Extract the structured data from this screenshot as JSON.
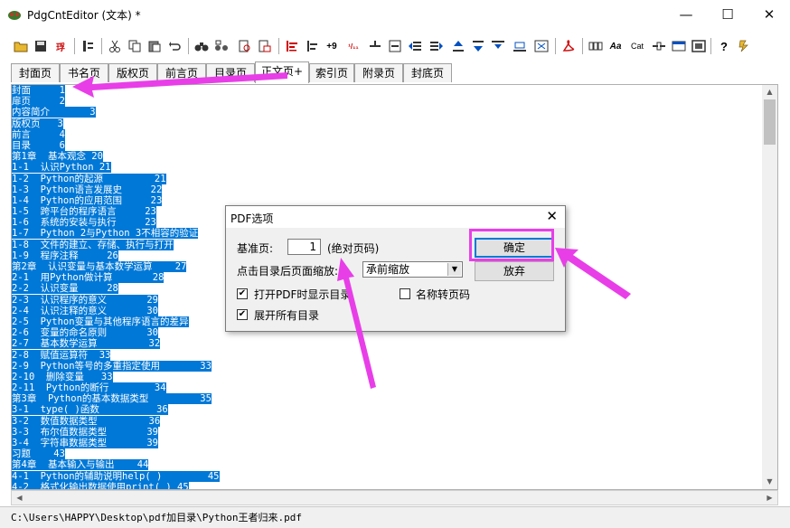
{
  "window": {
    "title": "PdgCntEditor (文本) *",
    "minimize": "—",
    "maximize": "☐",
    "close": "✕"
  },
  "toolbar": {
    "icons": [
      "open-folder-icon",
      "save-icon",
      "export-pdf-icon",
      "toc-icon",
      "cut-icon",
      "copy-icon",
      "paste-icon",
      "undo-icon",
      "find-icon",
      "find-replace-icon",
      "doc-search-icon",
      "doc-replace-icon",
      "align-left-icon",
      "indent-icon",
      "increase-page-icon",
      "renumber-icon",
      "subtract-icon",
      "add-page-icon",
      "outdent-icon",
      "indent-list-icon",
      "move-up-icon",
      "move-down-icon",
      "move-top-icon",
      "move-bottom-icon",
      "pdf-acrobat-icon",
      "columns-icon",
      "font-aa-icon",
      "cat-icon",
      "link-icon",
      "window-icon",
      "screenshot-icon",
      "help-icon",
      "about-icon"
    ],
    "labels": {
      "export": "琈",
      "increase": "+9",
      "renumber": "¹/₁₁",
      "font": "Aa",
      "cat": "Cat",
      "help": "?"
    }
  },
  "tabs": [
    {
      "label": "封面页"
    },
    {
      "label": "书名页"
    },
    {
      "label": "版权页"
    },
    {
      "label": "前言页"
    },
    {
      "label": "目录页"
    },
    {
      "label": "正文页+"
    },
    {
      "label": "索引页"
    },
    {
      "label": "附录页"
    },
    {
      "label": "封底页"
    }
  ],
  "active_tab": "正文页+",
  "editor_lines": [
    "封面     1",
    "扉页     2",
    "内容简介       3",
    "版权页   3",
    "前言     4",
    "目录     6",
    "第1章  基本观念 20",
    "1-1  认识Python 21",
    "1-2  Python的起源         21",
    "1-3  Python语言发展史     22",
    "1-4  Python的应用范围     23",
    "1-5  跨平台的程序语言     23",
    "1-6  系统的安装与执行     23",
    "1-7  Python 2与Python 3不相容的验证",
    "1-8  文件的建立、存储、执行与打开",
    "1-9  程序注释     26",
    "第2章  认识变量与基本数学运算    27",
    "2-1  用Python做计算       28",
    "2-2  认识变量     28",
    "2-3  认识程序的意义       29",
    "2-4  认识注释的意义       30",
    "2-5  Python变量与其他程序语言的差异",
    "2-6  变量的命名原则       30",
    "2-7  基本数学运算         32",
    "2-8  赋值运算符  33",
    "2-9  Python等号的多重指定使用       33",
    "2-10  删除变量   33",
    "2-11  Python的断行        34",
    "第3章  Python的基本数据类型         35",
    "3-1  type( )函数          36",
    "3-2  数值数据类型         36",
    "3-3  布尔值数据类型       39",
    "3-4  字符串数据类型       39",
    "习题    43",
    "第4章  基本输入与输出    44",
    "4-1  Python的辅助说明help( )        45",
    "4-2  格式化输出数据使用print( ) 45"
  ],
  "status": {
    "path": "C:\\Users\\HAPPY\\Desktop\\pdf加目录\\Python王者归来.pdf"
  },
  "dialog": {
    "title": "PDF选项",
    "close": "✕",
    "base_page_label": "基准页:",
    "base_page_value": "1",
    "absolute_note": "(绝对页码)",
    "zoom_label": "点击目录后页面缩放:",
    "zoom_value": "承前缩放",
    "ok": "确定",
    "cancel": "放弃",
    "show_toc_label": "打开PDF时显示目录",
    "show_toc_checked": true,
    "name_to_pagenum_label": "名称转页码",
    "name_to_pagenum_checked": false,
    "expand_all_label": "展开所有目录",
    "expand_all_checked": true,
    "check_mark": "✔"
  },
  "annotation_color": "#e83ee8",
  "selection_color": "#0078d7"
}
